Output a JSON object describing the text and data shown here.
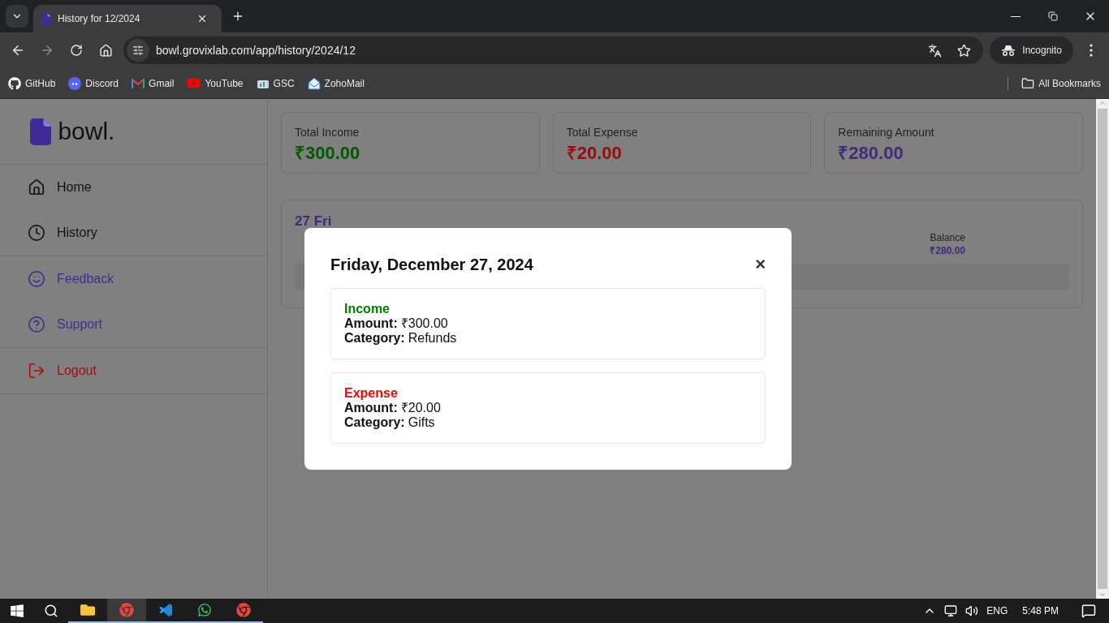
{
  "browser": {
    "tab_title": "History for 12/2024",
    "url": "bowl.grovixlab.com/app/history/2024/12",
    "profile": "Incognito",
    "bookmarks": [
      {
        "label": "GitHub",
        "kind": "github"
      },
      {
        "label": "Discord",
        "kind": "discord"
      },
      {
        "label": "Gmail",
        "kind": "gmail"
      },
      {
        "label": "YouTube",
        "kind": "youtube"
      },
      {
        "label": "GSC",
        "kind": "gsc"
      },
      {
        "label": "ZohoMail",
        "kind": "zoho"
      }
    ],
    "all_bookmarks": "All Bookmarks"
  },
  "sidebar": {
    "logo": "bowl.",
    "groups": [
      [
        {
          "label": "Home",
          "kind": "home",
          "color": "#111111"
        },
        {
          "label": "History",
          "kind": "history",
          "color": "#111111"
        }
      ],
      [
        {
          "label": "Feedback",
          "kind": "feedback",
          "color": "#3d2f8a"
        },
        {
          "label": "Support",
          "kind": "support",
          "color": "#3d2f8a"
        }
      ],
      [
        {
          "label": "Logout",
          "kind": "logout",
          "color": "#a01010"
        }
      ]
    ]
  },
  "summary": [
    {
      "label": "Total Income",
      "value": "₹300.00",
      "color": "#005a00"
    },
    {
      "label": "Total Expense",
      "value": "₹20.00",
      "color": "#9c0a0a"
    },
    {
      "label": "Remaining Amount",
      "value": "₹280.00",
      "color": "#3f2b7a"
    }
  ],
  "day": {
    "title": "27 Fri",
    "balance_label": "Balance",
    "balance": "₹280.00"
  },
  "modal": {
    "title": "Friday, December 27, 2024",
    "close": "×",
    "entries": [
      {
        "type": "Income",
        "color": "#008000",
        "amount_label": "Amount:",
        "amount": "₹300.00",
        "category_label": "Category:",
        "category": "Refunds"
      },
      {
        "type": "Expense",
        "color": "#ff0000",
        "amount_label": "Amount:",
        "amount": "₹20.00",
        "category_label": "Category:",
        "category": "Gifts"
      }
    ]
  },
  "taskbar": {
    "apps": [
      {
        "kind": "folder",
        "selected": false
      },
      {
        "kind": "chrome",
        "selected": true
      },
      {
        "kind": "code",
        "selected": false
      },
      {
        "kind": "whatsapp",
        "selected": false
      },
      {
        "kind": "chrome",
        "selected": false
      }
    ],
    "language": "ENG",
    "time": "5:48 PM"
  }
}
